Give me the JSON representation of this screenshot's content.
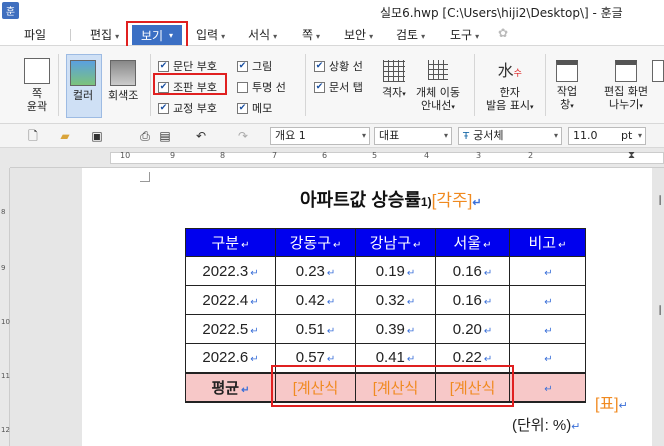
{
  "window": {
    "app_icon": "훈",
    "title": "실모6.hwp [C:\\Users\\hiji2\\Desktop\\] - 훈글"
  },
  "menu": {
    "file": "파일",
    "items": [
      "편집",
      "보기",
      "입력",
      "서식",
      "쪽",
      "보안",
      "검토",
      "도구"
    ],
    "active": "보기"
  },
  "ribbon": {
    "page_outline": [
      "쪽",
      "윤곽"
    ],
    "color": "컬러",
    "grayscale": "회색조",
    "checks": {
      "paragraph_mark": {
        "label": "문단 부호",
        "checked": true
      },
      "format_mark": {
        "label": "조판 부호",
        "checked": true
      },
      "proofread_mark": {
        "label": "교정 부호",
        "checked": true
      },
      "picture": {
        "label": "그림",
        "checked": true
      },
      "transparent_line": {
        "label": "투명 선",
        "checked": false
      },
      "memo": {
        "label": "메모",
        "checked": true
      },
      "status_line": {
        "label": "상황 선",
        "checked": true
      },
      "doc_tab": {
        "label": "문서 탭",
        "checked": true
      }
    },
    "grid": "격자",
    "object_move": [
      "개체 이동",
      "안내선"
    ],
    "hanja": [
      "한자",
      "발음 표시"
    ],
    "work_window": [
      "작업",
      "창"
    ],
    "edit_screen": [
      "편집 화면",
      "나누기"
    ]
  },
  "toolbar": {
    "style": "개요 1",
    "lang": "대표",
    "font": "궁서체",
    "size": "11.0",
    "unit": "pt"
  },
  "ruler": {
    "h_numbers": [
      "10",
      "9",
      "8",
      "7",
      "6",
      "5",
      "4",
      "3",
      "2"
    ],
    "v_numbers": [
      "8",
      "9",
      "10",
      "11",
      "12"
    ]
  },
  "document": {
    "title": "아파트값 상승률",
    "footnote_num": "1)",
    "footnote_tag": "[각주]",
    "table": {
      "headers": [
        "구분",
        "강동구",
        "강남구",
        "서울",
        "비고"
      ],
      "rows": [
        [
          "2022.3",
          "0.23",
          "0.19",
          "0.16",
          ""
        ],
        [
          "2022.4",
          "0.42",
          "0.32",
          "0.16",
          ""
        ],
        [
          "2022.5",
          "0.51",
          "0.39",
          "0.20",
          ""
        ],
        [
          "2022.6",
          "0.57",
          "0.41",
          "0.22",
          ""
        ]
      ],
      "avg_label": "평균",
      "calc": [
        "[계산식",
        "[계산식",
        "[계산식"
      ]
    },
    "caption_tag": "[표]",
    "unit_note": "(단위: %)",
    "para_mark": "↵"
  },
  "colors": {
    "header_bg": "#0000ee",
    "avg_bg": "#f7c8c8",
    "accent_orange": "#f08a20",
    "highlight_red": "#e02020",
    "menu_active": "#3b6fc4"
  }
}
